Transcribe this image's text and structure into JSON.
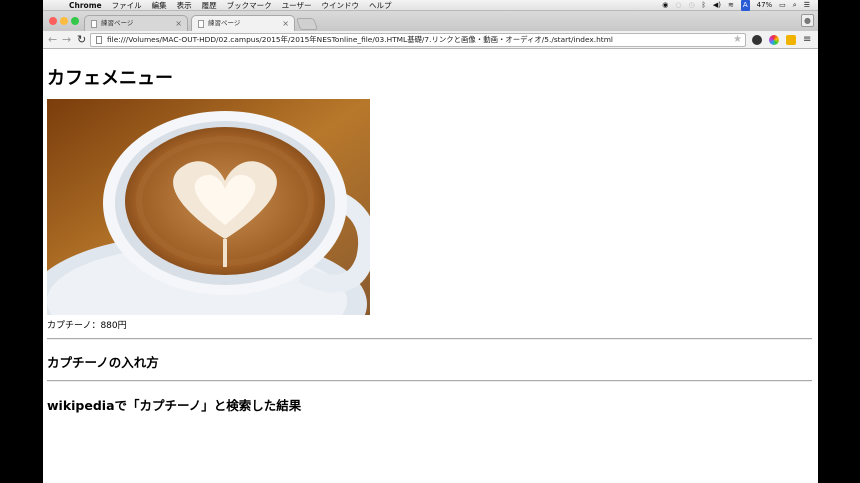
{
  "menubar": {
    "app_name": "Chrome",
    "items": [
      "ファイル",
      "編集",
      "表示",
      "履歴",
      "ブックマーク",
      "ユーザー",
      "ウインドウ",
      "ヘルプ"
    ],
    "battery": "47%"
  },
  "tabs": [
    {
      "title": "練習ページ",
      "active": false
    },
    {
      "title": "練習ページ",
      "active": true
    }
  ],
  "address_bar": {
    "url": "file:///Volumes/MAC-OUT-HDD/02.campus/2015年/2015年NESTonline_file/03.HTML基礎/7.リンクと画像・動画・オーディオ/5./start/index.html"
  },
  "page": {
    "title": "カフェメニュー",
    "caption": "カプチーノ：880円",
    "heading_howto": "カプチーノの入れ方",
    "heading_wiki": "wikipediaで「カプチーノ」と検索した結果"
  },
  "colors": {
    "close": "#fc605c",
    "minimize": "#fdbc40",
    "zoom": "#34c84a"
  }
}
